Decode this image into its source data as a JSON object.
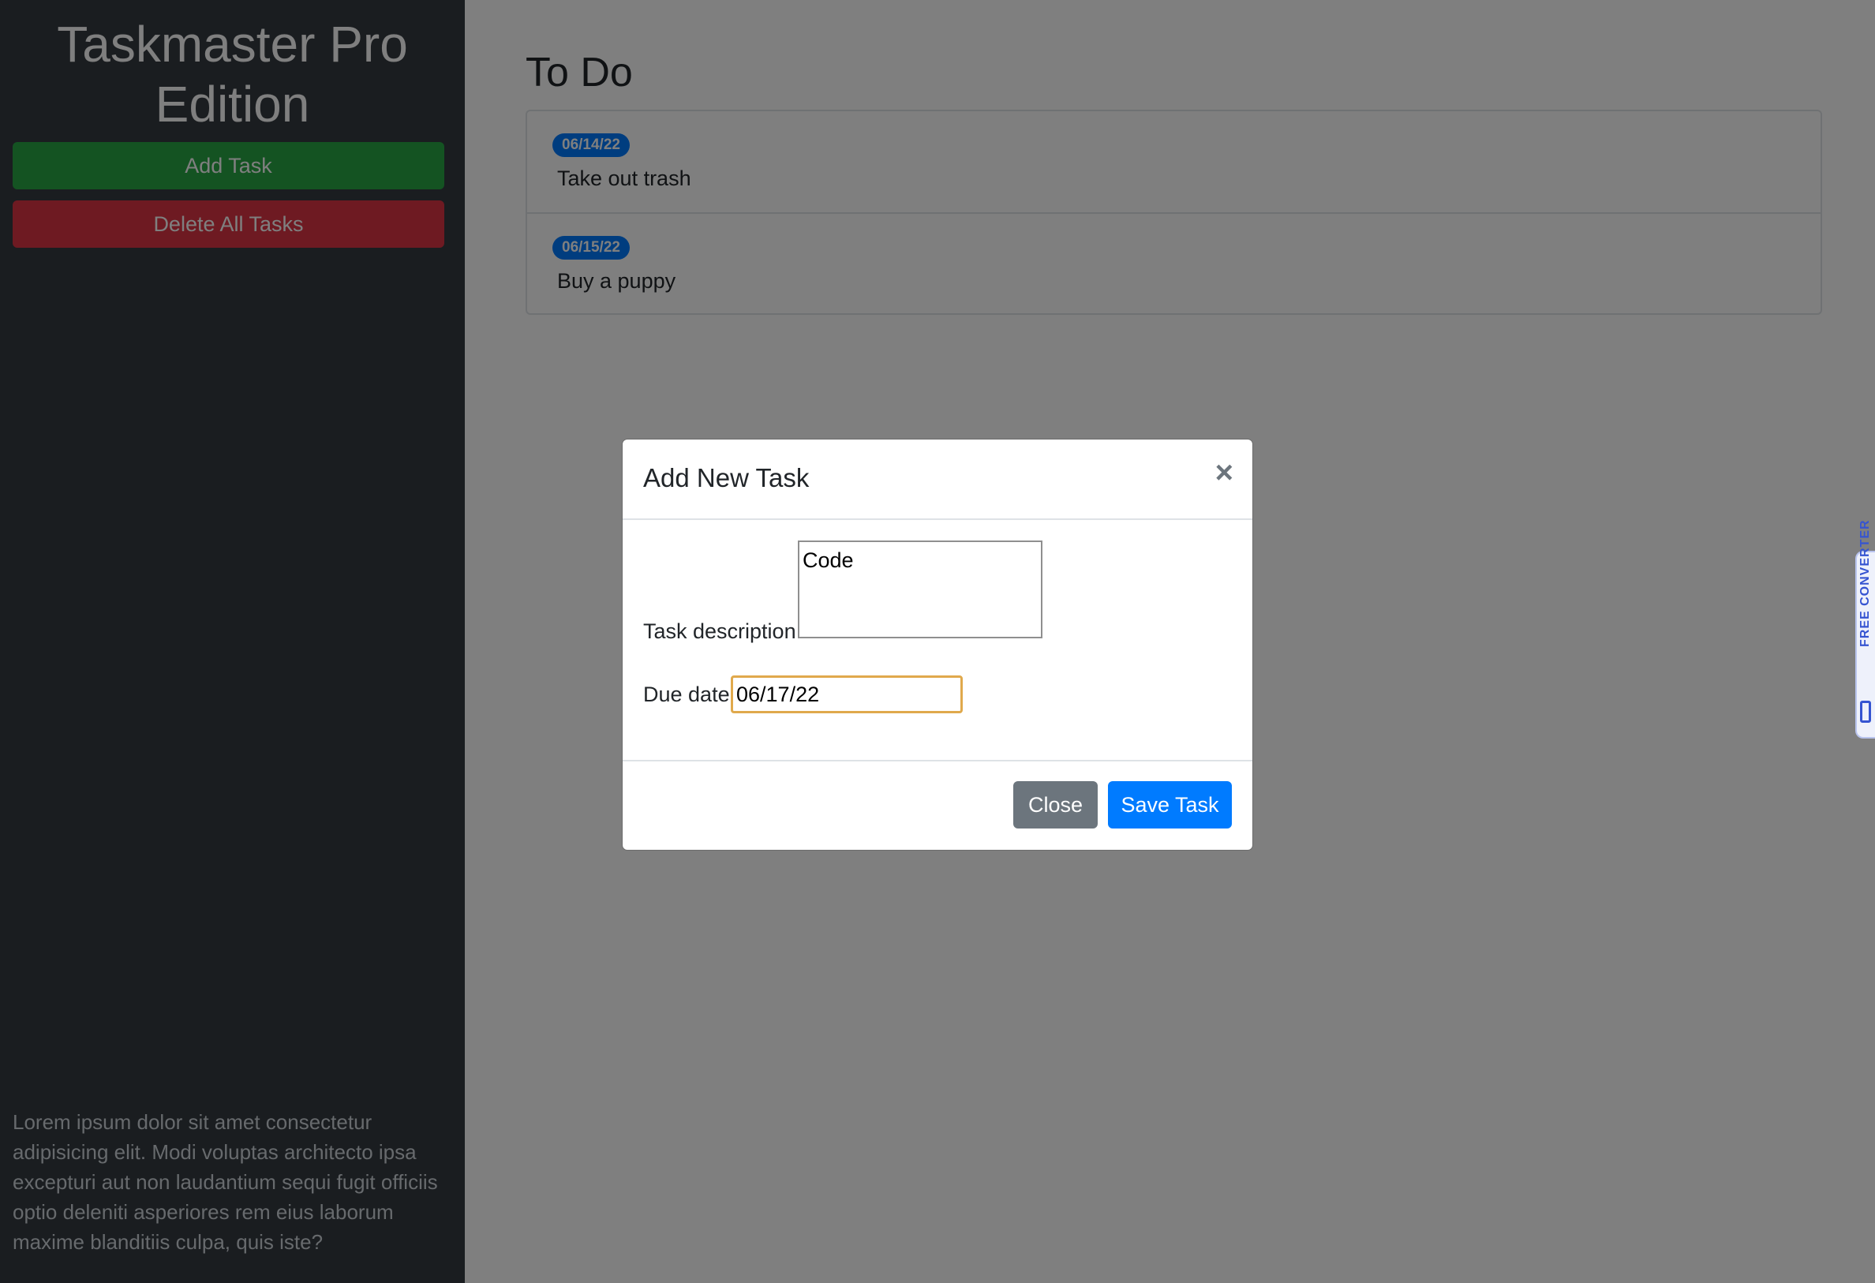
{
  "sidebar": {
    "title": "Taskmaster Pro Edition",
    "add_task_label": "Add Task",
    "delete_all_label": "Delete All Tasks",
    "footer_text": "Lorem ipsum dolor sit amet consectetur adipisicing elit. Modi voluptas architecto ipsa excepturi aut non laudantium sequi fugit officiis optio deleniti asperiores rem eius laborum maxime blanditiis culpa, quis iste?"
  },
  "main": {
    "section_title": "To Do",
    "tasks": [
      {
        "date": "06/14/22",
        "text": "Take out trash"
      },
      {
        "date": "06/15/22",
        "text": "Buy a puppy"
      }
    ]
  },
  "modal": {
    "title": "Add New Task",
    "close_icon": "×",
    "description_label": "Task description",
    "description_value": "Code",
    "due_label": "Due date",
    "due_value": "06/17/22",
    "close_label": "Close",
    "save_label": "Save Task"
  },
  "side_widget": {
    "text": "FREE CONVERTER"
  },
  "colors": {
    "sidebar_bg": "#343a40",
    "success": "#28a745",
    "danger": "#dc3545",
    "primary": "#007bff",
    "secondary": "#6c757d",
    "focus_border": "#e0a94c"
  }
}
